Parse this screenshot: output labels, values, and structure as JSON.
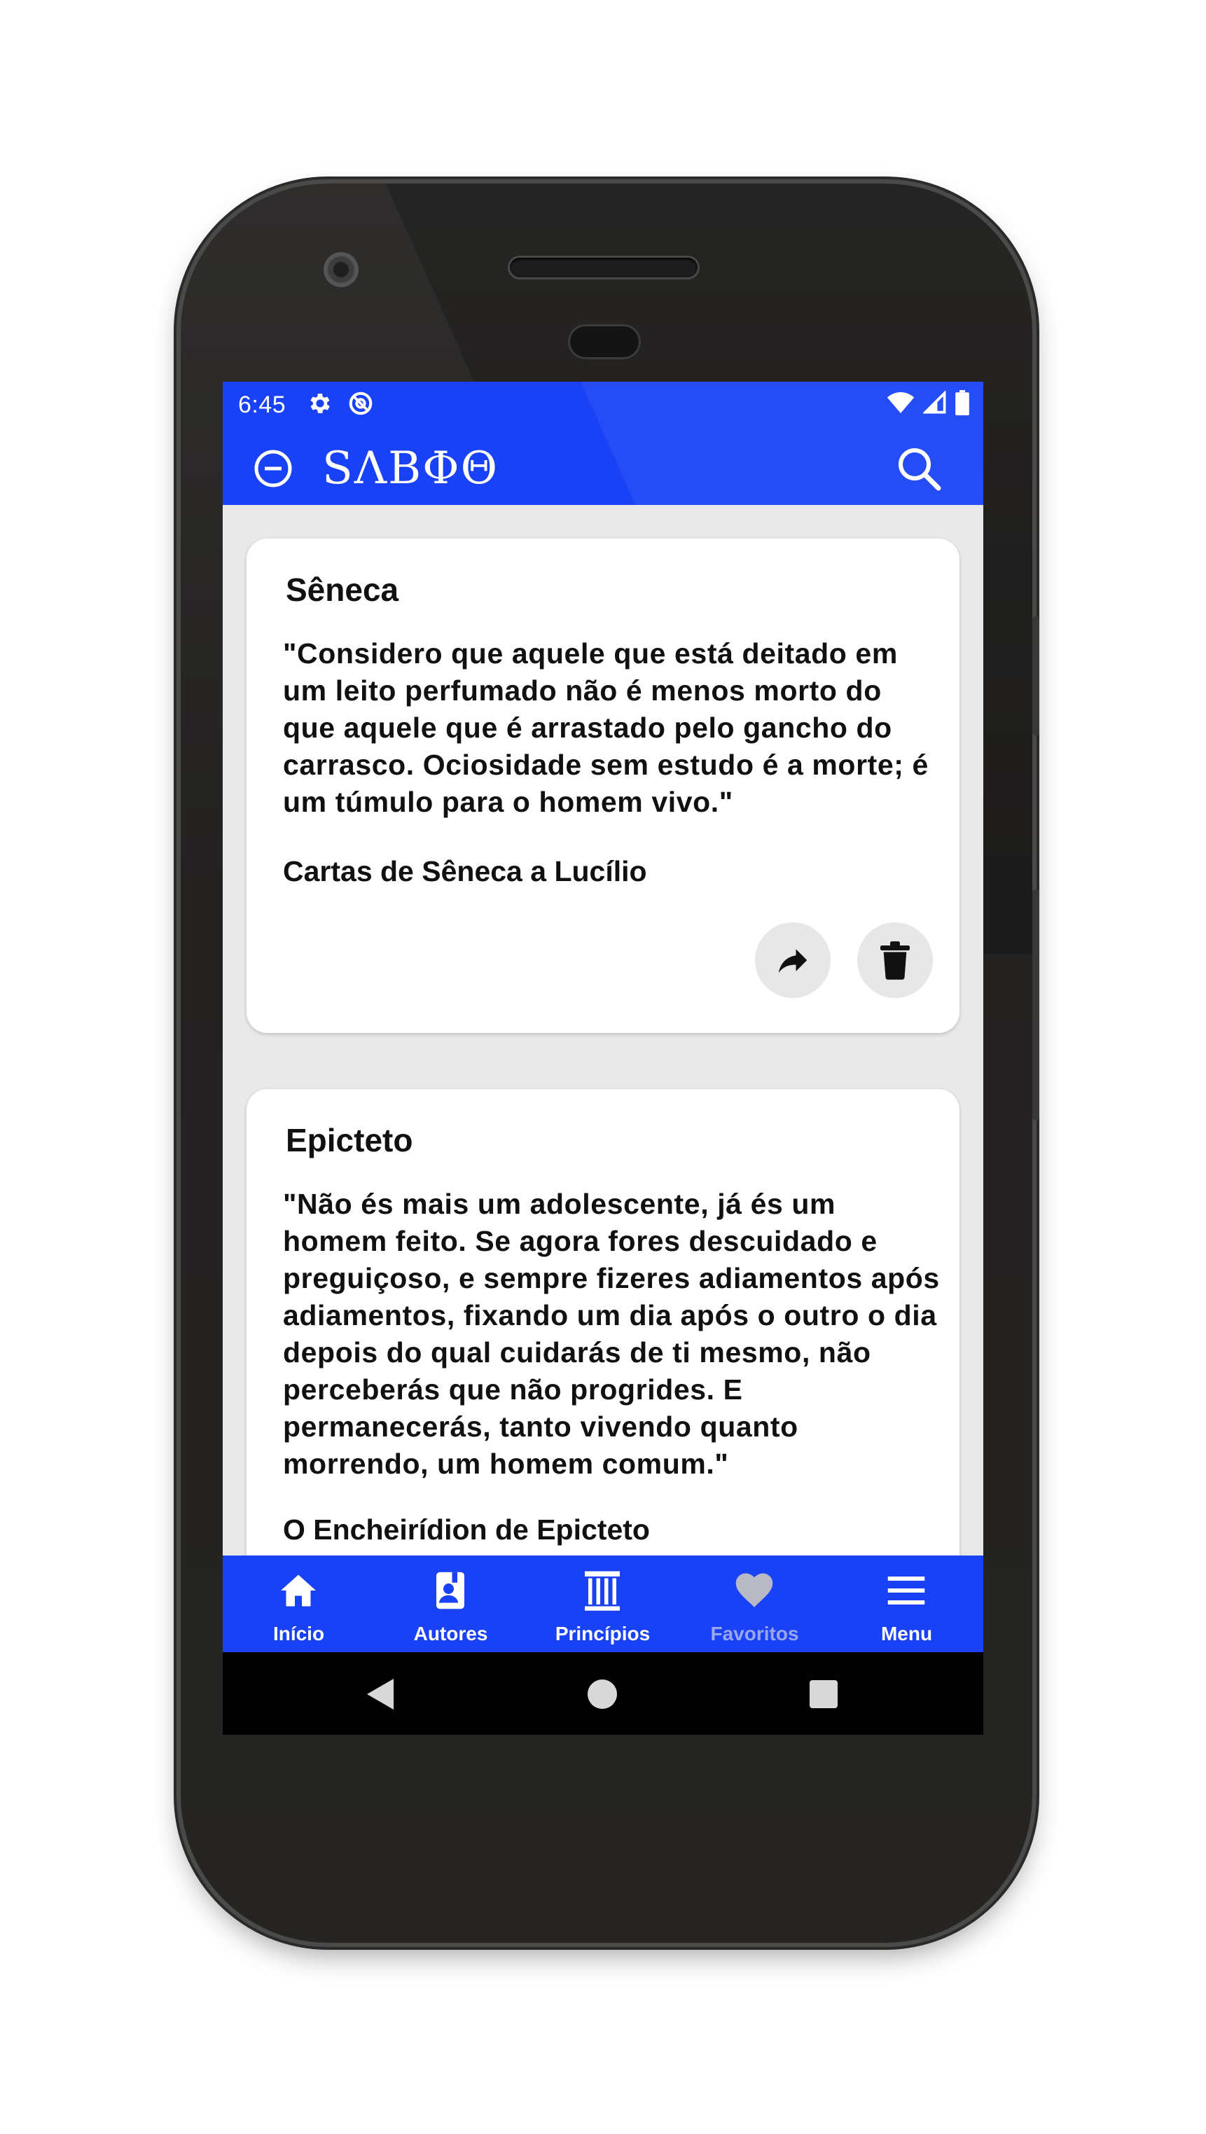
{
  "status_bar": {
    "time": "6:45",
    "left_icons": [
      "settings-icon",
      "sync-off-icon"
    ],
    "right_icons": [
      "wifi-icon",
      "signal-icon",
      "battery-icon"
    ]
  },
  "app_bar": {
    "title": "SΛBΦΘ",
    "logo_icon": "theta-logo-icon",
    "search_icon": "search-icon"
  },
  "favorites": [
    {
      "author": "Sêneca",
      "quote": "\"Considero que aquele que está deitado em um leito perfumado não é menos morto do que aquele que é arrastado pelo gancho do carrasco. Ociosidade sem estudo é a morte; é um túmulo para o homem vivo.\"",
      "source": "Cartas de Sêneca a Lucílio",
      "actions": [
        "share-icon",
        "trash-icon"
      ]
    },
    {
      "author": "Epicteto",
      "quote": "\"Não és mais um adolescente, já és um homem feito. Se agora fores descuidado e preguiçoso, e sempre fizeres adiamentos após adiamentos, fixando um dia após o outro o dia depois do qual cuidarás de ti mesmo, não perceberás que não progrides. E permanecerás, tanto vivendo quanto morrendo, um homem comum.\"",
      "source": "O Encheirídion de Epicteto"
    }
  ],
  "bottom_nav": {
    "items": [
      {
        "label": "Início",
        "icon": "home-icon"
      },
      {
        "label": "Autores",
        "icon": "author-book-icon"
      },
      {
        "label": "Princípios",
        "icon": "column-icon"
      },
      {
        "label": "Favoritos",
        "icon": "heart-icon",
        "active": true
      },
      {
        "label": "Menu",
        "icon": "menu-icon"
      }
    ]
  },
  "system_nav": [
    "back-icon",
    "home-circle-icon",
    "recents-icon"
  ],
  "colors": {
    "primary": "#1941f5",
    "background": "#e9e9e9",
    "card": "#ffffff",
    "active_nav": "#9aa6ee"
  }
}
